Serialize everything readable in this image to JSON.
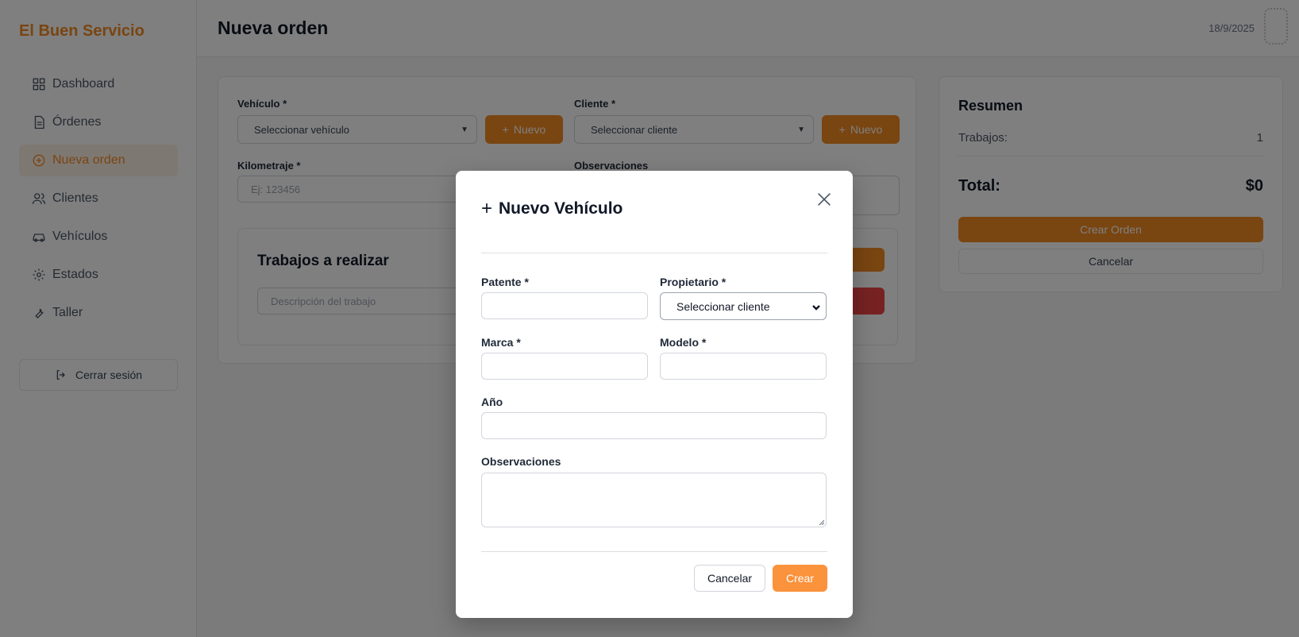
{
  "app": {
    "brand": "El Buen Servicio"
  },
  "sidebar": {
    "items": [
      {
        "label": "Dashboard",
        "icon": "dashboard-icon"
      },
      {
        "label": "Órdenes",
        "icon": "document-icon"
      },
      {
        "label": "Nueva orden",
        "icon": "plus-circle-icon",
        "active": true
      },
      {
        "label": "Clientes",
        "icon": "users-icon"
      },
      {
        "label": "Vehículos",
        "icon": "car-icon"
      },
      {
        "label": "Estados",
        "icon": "gear-icon"
      },
      {
        "label": "Taller",
        "icon": "wrench-icon"
      }
    ],
    "logout_label": "Cerrar sesión"
  },
  "header": {
    "title": "Nueva orden",
    "date": "18/9/2025"
  },
  "form": {
    "vehicle_label": "Vehículo *",
    "vehicle_select": "Seleccionar vehículo",
    "vehicle_new": "Nuevo",
    "client_label": "Cliente *",
    "client_select": "Seleccionar cliente",
    "client_new": "Nuevo",
    "km_label": "Kilometraje *",
    "km_placeholder": "Ej: 123456",
    "obs_label": "Observaciones"
  },
  "jobs": {
    "title": "Trabajos a realizar",
    "desc_placeholder": "Descripción del trabajo"
  },
  "summary": {
    "title": "Resumen",
    "jobs_label": "Trabajos:",
    "jobs_count": "1",
    "total_label": "Total:",
    "total_value": "$0",
    "create_label": "Crear Orden",
    "cancel_label": "Cancelar"
  },
  "modal": {
    "title": "Nuevo Vehículo",
    "patente_label": "Patente *",
    "propietario_label": "Propietario *",
    "propietario_value": "Seleccionar cliente",
    "marca_label": "Marca *",
    "modelo_label": "Modelo *",
    "anio_label": "Año",
    "obs_label": "Observaciones",
    "cancel_label": "Cancelar",
    "create_label": "Crear"
  },
  "colors": {
    "accent": "#f28a22",
    "danger": "#ef4444",
    "create_button": "#fb923c"
  }
}
